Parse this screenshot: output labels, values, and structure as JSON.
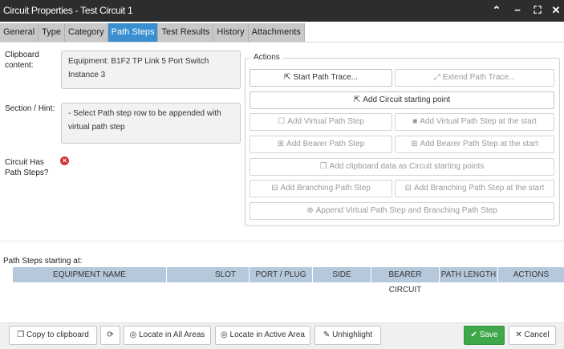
{
  "window": {
    "title": "Circuit Properties - Test Circuit 1"
  },
  "tabs": [
    {
      "label": "General"
    },
    {
      "label": "Type"
    },
    {
      "label": "Category"
    },
    {
      "label": "Path Steps"
    },
    {
      "label": "Test Results"
    },
    {
      "label": "History"
    },
    {
      "label": "Attachments"
    }
  ],
  "form": {
    "clipboard_label": "Clipboard content:",
    "clipboard_value": "Equipment: B1F2 TP Link 5 Port Switch Instance 3",
    "hint_label": "Section / Hint:",
    "hint_value": "- Select Path step row to be appended with virtual path step",
    "has_steps_label": "Circuit Has Path Steps?",
    "has_steps_icon": "error-x-icon"
  },
  "actions": {
    "legend": "Actions",
    "start_trace": "Start Path Trace...",
    "extend_trace": "Extend Path Trace...",
    "add_start_point": "Add Circuit starting point",
    "add_virtual": "Add Virtual Path Step",
    "add_virtual_start": "Add Virtual Path Step at the start",
    "add_bearer": "Add Bearer Path Step",
    "add_bearer_start": "Add Bearer Path Step at the start",
    "add_clipboard": "Add clipboard data as Circuit starting points",
    "add_branching": "Add Branching Path Step",
    "add_branching_start": "Add Branching Path Step at the start",
    "append_virtual_branching": "Append Virtual Path Step and Branching Path Step"
  },
  "steps": {
    "label": "Path Steps starting at:",
    "columns": [
      "EQUIPMENT NAME",
      "SLOT",
      "PORT / PLUG",
      "SIDE",
      "BEARER CIRCUIT",
      "PATH LENGTH",
      "ACTIONS"
    ]
  },
  "footer": {
    "copy": "Copy to clipboard",
    "locate_all": "Locate in All Areas",
    "locate_active": "Locate in Active Area",
    "unhighlight": "Unhighlight",
    "save": "Save",
    "cancel": "Cancel"
  },
  "colors": {
    "accent": "#3a8fd0",
    "save": "#3fa84a",
    "error": "#d9363e",
    "header_row": "#b6c8db"
  }
}
